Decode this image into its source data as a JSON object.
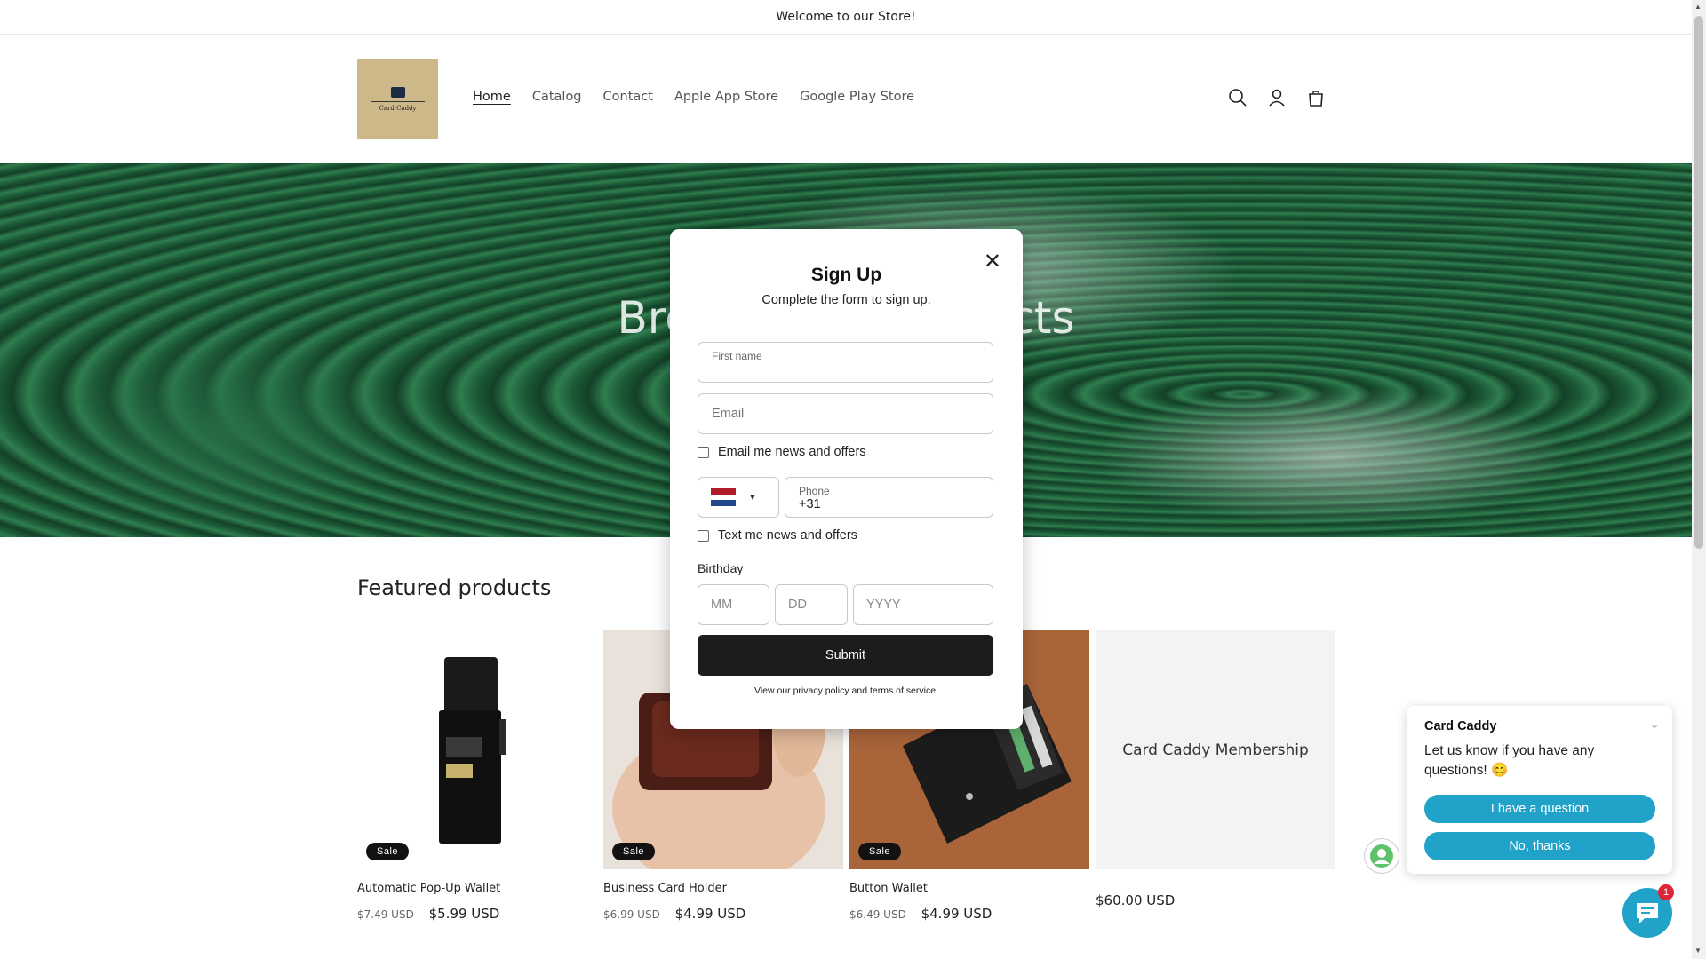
{
  "announcement": "Welcome to our Store!",
  "header": {
    "logo_text": "Card Caddy",
    "nav": [
      "Home",
      "Catalog",
      "Contact",
      "Apple App Store",
      "Google Play Store"
    ]
  },
  "hero": {
    "title": "Browse our products"
  },
  "featured": {
    "title": "Featured products",
    "products": [
      {
        "title": "Automatic Pop-Up Wallet",
        "old_price": "$7.49 USD",
        "price": "$5.99 USD",
        "badge": "Sale"
      },
      {
        "title": "Business Card Holder",
        "old_price": "$6.99 USD",
        "price": "$4.99 USD",
        "badge": "Sale"
      },
      {
        "title": "Button Wallet",
        "old_price": "$6.49 USD",
        "price": "$4.99 USD",
        "badge": "Sale"
      },
      {
        "title": "Card Caddy Membership",
        "price": "$60.00 USD"
      }
    ]
  },
  "modal": {
    "title": "Sign Up",
    "subtitle": "Complete the form to sign up.",
    "first_name_label": "First name",
    "email_placeholder": "Email",
    "email_optin": "Email me news and offers",
    "phone_label": "Phone",
    "phone_value": "+31",
    "text_optin": "Text me news and offers",
    "birthday_label": "Birthday",
    "mm": "MM",
    "dd": "DD",
    "yyyy": "YYYY",
    "submit": "Submit",
    "legal": "View our privacy policy and terms of service."
  },
  "chat": {
    "name": "Card Caddy",
    "message": "Let us know if you have any questions! 😊",
    "btn_question": "I have a question",
    "btn_no": "No, thanks",
    "badge": "1"
  },
  "colors": {
    "accent": "#21a2c8",
    "hero_green": "#1f6a3f",
    "logo_bg": "#cdb889"
  }
}
